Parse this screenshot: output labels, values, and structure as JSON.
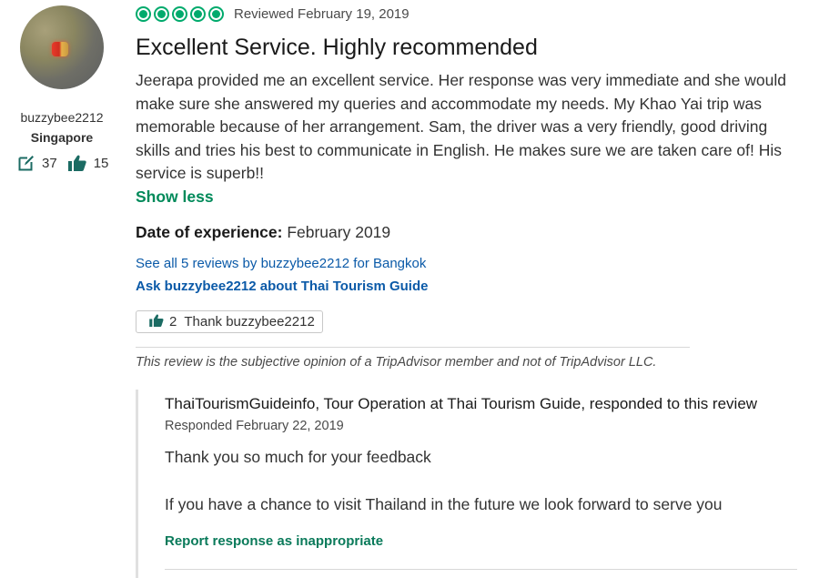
{
  "reviewer": {
    "username": "buzzybee2212",
    "location": "Singapore",
    "contributions": "37",
    "helpful_votes": "15"
  },
  "review": {
    "rating": 5,
    "reviewed_date": "Reviewed February 19, 2019",
    "title": "Excellent Service. Highly recommended",
    "body": "Jeerapa provided me an excellent service. Her response was very immediate and she would make sure she answered my queries and accommodate my needs. My Khao Yai trip was memorable because of her arrangement. Sam, the driver was a very friendly, good driving skills and tries his best to communicate in English. He makes sure we are taken care of! His service is superb!!",
    "show_less_label": "Show less",
    "date_of_experience_label": "Date of experience:",
    "date_of_experience_value": "February 2019",
    "see_all_link": "See all 5 reviews by buzzybee2212 for Bangkok",
    "ask_link": "Ask buzzybee2212 about Thai Tourism Guide",
    "thank_count": "2",
    "thank_label": "Thank buzzybee2212",
    "disclaimer": "This review is the subjective opinion of a TripAdvisor member and not of TripAdvisor LLC."
  },
  "response": {
    "header": "ThaiTourismGuideinfo, Tour Operation at Thai Tourism Guide, responded to this review",
    "date": "Responded February 22, 2019",
    "paragraph1": "Thank you so much for your feedback",
    "paragraph2": "If you have a chance to visit Thailand in the future we look forward to serve you",
    "report_link": "Report response as inappropriate"
  },
  "colors": {
    "bubble_green": "#00aa6c",
    "link_blue": "#0b5aa8",
    "show_less_green": "#008a5a",
    "report_green": "#0a7a5a",
    "icon_teal": "#1b6b63"
  },
  "icons": {
    "contributions": "edit-icon",
    "helpful": "thumbs-up-icon"
  }
}
